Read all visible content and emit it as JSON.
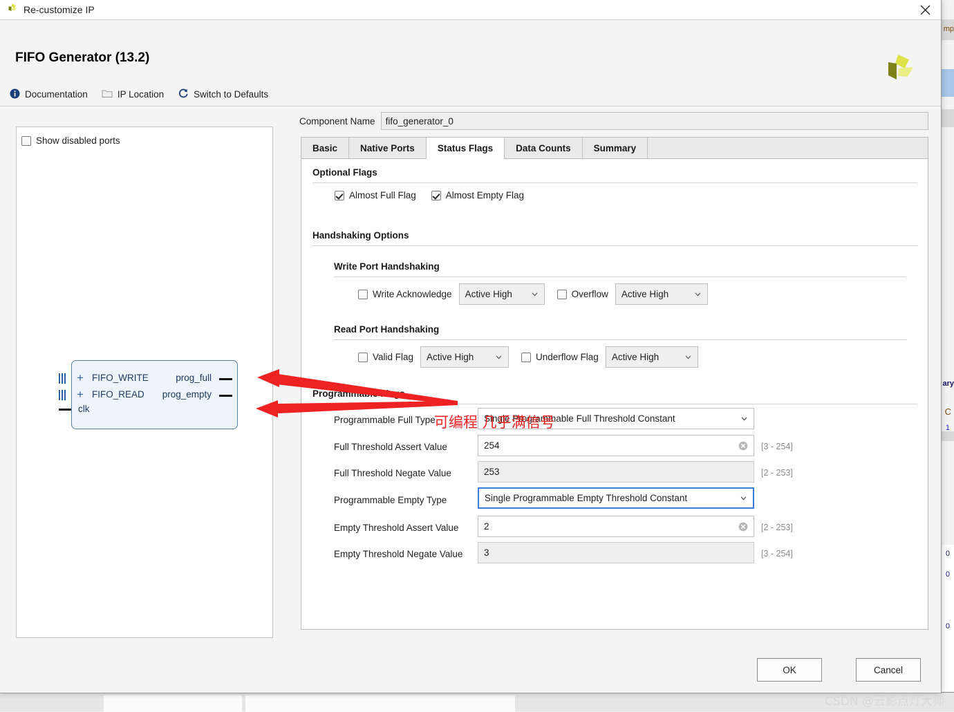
{
  "window": {
    "title": "Re-customize IP",
    "close_icon": "close-icon",
    "app_logo_icon": "xilinx-logo-icon"
  },
  "header": {
    "ip_title": "FIFO Generator (13.2)",
    "tools": [
      {
        "label": "Documentation",
        "icon": "info-icon"
      },
      {
        "label": "IP Location",
        "icon": "folder-icon"
      },
      {
        "label": "Switch to Defaults",
        "icon": "refresh-icon"
      }
    ]
  },
  "preview": {
    "show_disabled_ports_label": "Show disabled ports",
    "show_disabled_ports_checked": false,
    "symbol": {
      "inputs": [
        "FIFO_WRITE",
        "FIFO_READ"
      ],
      "clock": "clk",
      "outputs": [
        "prog_full",
        "prog_empty"
      ]
    }
  },
  "component": {
    "label": "Component Name",
    "value": "fifo_generator_0"
  },
  "tabs": [
    {
      "label": "Basic",
      "active": false
    },
    {
      "label": "Native Ports",
      "active": false
    },
    {
      "label": "Status Flags",
      "active": true
    },
    {
      "label": "Data Counts",
      "active": false
    },
    {
      "label": "Summary",
      "active": false
    }
  ],
  "optional_flags": {
    "title": "Optional Flags",
    "items": [
      {
        "label": "Almost Full Flag",
        "checked": true
      },
      {
        "label": "Almost Empty Flag",
        "checked": true
      }
    ]
  },
  "handshaking": {
    "title": "Handshaking Options",
    "write": {
      "title": "Write Port Handshaking",
      "write_ack": {
        "label": "Write Acknowledge",
        "checked": false,
        "polarity": "Active High"
      },
      "overflow": {
        "label": "Overflow",
        "checked": false,
        "polarity": "Active High"
      }
    },
    "read": {
      "title": "Read Port Handshaking",
      "valid": {
        "label": "Valid Flag",
        "checked": false,
        "polarity": "Active High"
      },
      "underflow": {
        "label": "Underflow Flag",
        "checked": false,
        "polarity": "Active High"
      }
    }
  },
  "programmable_flags": {
    "title": "Programmable Flags",
    "full_type": {
      "label": "Programmable Full Type",
      "value": "Single Programmable Full Threshold Constant"
    },
    "full_assert": {
      "label": "Full Threshold Assert Value",
      "value": "254",
      "range": "[3 - 254]"
    },
    "full_negate": {
      "label": "Full Threshold Negate Value",
      "value": "253",
      "range": "[2 - 253]"
    },
    "empty_type": {
      "label": "Programmable Empty Type",
      "value": "Single Programmable Empty Threshold Constant"
    },
    "empty_assert": {
      "label": "Empty Threshold Assert Value",
      "value": "2",
      "range": "[2 - 253]"
    },
    "empty_negate": {
      "label": "Empty Threshold Negate Value",
      "value": "3",
      "range": "[3 - 254]"
    }
  },
  "footer": {
    "ok_label": "OK",
    "cancel_label": "Cancel"
  },
  "annotations": {
    "note_text": "可编程 几乎满信号",
    "note_color": "#ee2222",
    "watermark": "CSDN @云影点灯大师"
  },
  "background": {
    "fragment_mp": "mp",
    "fragment_ary": "ary",
    "fragment_c": "C",
    "fragment_1": "1",
    "fragment_o1": "0",
    "fragment_o2": "0",
    "fragment_o3": "0"
  }
}
